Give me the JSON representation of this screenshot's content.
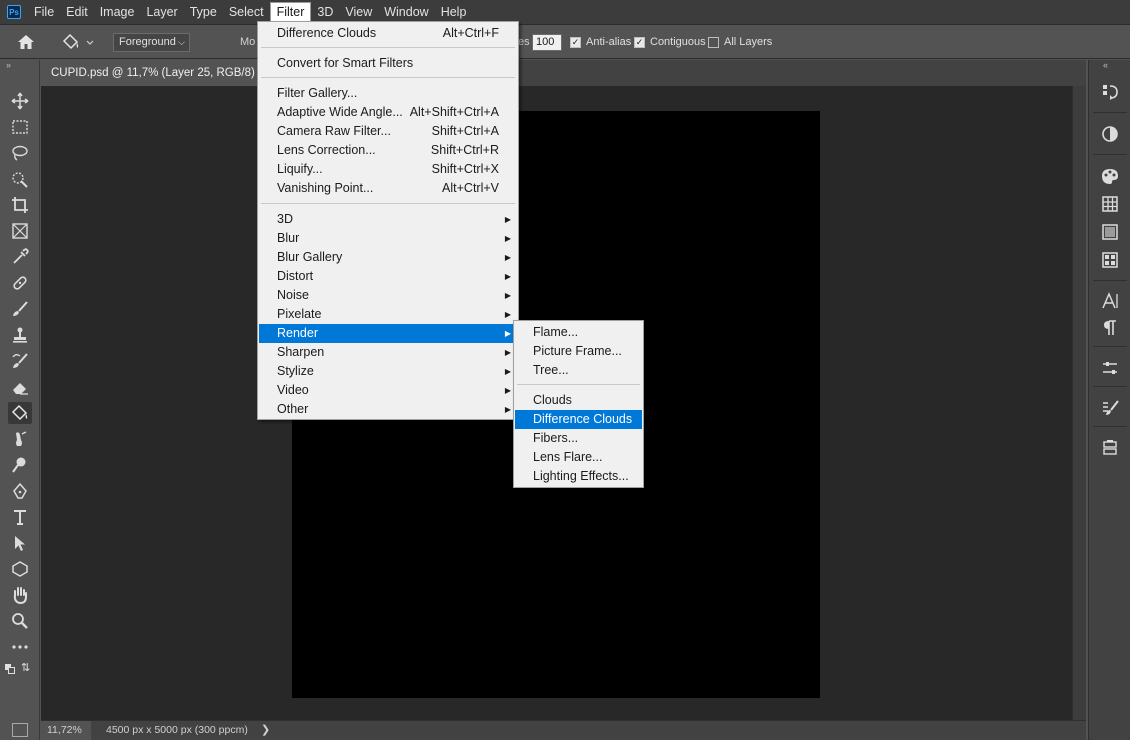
{
  "menubar": {
    "logo": "Ps",
    "items": [
      "File",
      "Edit",
      "Image",
      "Layer",
      "Type",
      "Select",
      "Filter",
      "3D",
      "View",
      "Window",
      "Help"
    ],
    "active": "Filter"
  },
  "options": {
    "fill_source": "Foreground",
    "mode_label": "Mo",
    "tolerance_label": "es",
    "tolerance_value": "100",
    "anti_alias": {
      "label": "Anti-alias",
      "checked": true
    },
    "contiguous": {
      "label": "Contiguous",
      "checked": true
    },
    "all_layers": {
      "label": "All Layers",
      "checked": false
    }
  },
  "document": {
    "tab_title": "CUPID.psd @ 11,7% (Layer 25, RGB/8) *",
    "canvas_color": "#000000"
  },
  "status": {
    "zoom": "11,72%",
    "doc_size": "4500 px x 5000 px (300 ppcm)",
    "arrow": "❯"
  },
  "filter_menu": {
    "top_items": [
      {
        "label": "Difference Clouds",
        "shortcut": "Alt+Ctrl+F"
      }
    ],
    "smart": {
      "label": "Convert for Smart Filters"
    },
    "filters": [
      {
        "label": "Filter Gallery...",
        "shortcut": ""
      },
      {
        "label": "Adaptive Wide Angle...",
        "shortcut": "Alt+Shift+Ctrl+A"
      },
      {
        "label": "Camera Raw Filter...",
        "shortcut": "Shift+Ctrl+A"
      },
      {
        "label": "Lens Correction...",
        "shortcut": "Shift+Ctrl+R"
      },
      {
        "label": "Liquify...",
        "shortcut": "Shift+Ctrl+X"
      },
      {
        "label": "Vanishing Point...",
        "shortcut": "Alt+Ctrl+V"
      }
    ],
    "submenus": [
      "3D",
      "Blur",
      "Blur Gallery",
      "Distort",
      "Noise",
      "Pixelate",
      "Render",
      "Sharpen",
      "Stylize",
      "Video",
      "Other"
    ],
    "highlighted": "Render"
  },
  "render_menu": {
    "group1": [
      "Flame...",
      "Picture Frame...",
      "Tree..."
    ],
    "group2": [
      "Clouds",
      "Difference Clouds",
      "Fibers...",
      "Lens Flare...",
      "Lighting Effects..."
    ],
    "highlighted": "Difference Clouds"
  },
  "colors": {
    "highlight": "#0078d7",
    "foreground": "#000000",
    "background": "#ffffff"
  },
  "icons": {
    "tools": [
      "move-icon",
      "marquee-icon",
      "lasso-icon",
      "quick-select-icon",
      "crop-icon",
      "frame-icon",
      "eyedropper-icon",
      "healing-brush-icon",
      "brush-icon",
      "clone-stamp-icon",
      "history-brush-icon",
      "eraser-icon",
      "paint-bucket-icon",
      "smudge-icon",
      "dodge-icon",
      "pen-icon",
      "type-icon",
      "path-select-icon",
      "shape-icon",
      "hand-icon",
      "zoom-icon",
      "more-tools-icon"
    ],
    "right_panel": [
      "history-icon",
      "adjustments-icon",
      "color-icon",
      "swatches-icon",
      "gradients-icon",
      "patterns-icon",
      "character-icon",
      "paragraph-icon",
      "properties-icon",
      "brush-settings-icon",
      "libraries-icon"
    ]
  }
}
